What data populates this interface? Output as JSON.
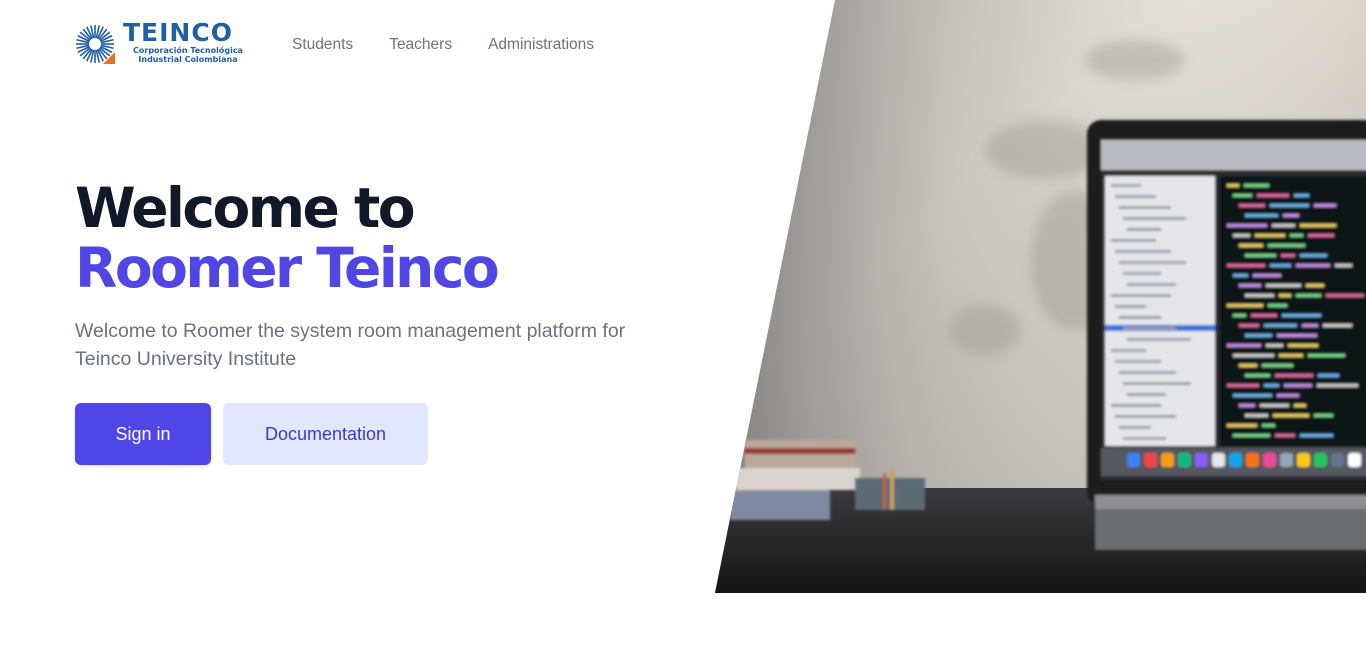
{
  "brand": {
    "name": "TEINCO",
    "subtitle_line1": "Corporación Tecnológica",
    "subtitle_line2": "Industrial Colombiana",
    "color": "#1f5fa6",
    "accent": "#e37222"
  },
  "nav": {
    "items": [
      {
        "label": "Students"
      },
      {
        "label": "Teachers"
      },
      {
        "label": "Administrations"
      }
    ]
  },
  "hero": {
    "title_line1": "Welcome to",
    "title_line2": "Roomer Teinco",
    "description": "Welcome to Roomer the system room management platform for Teinco University Institute",
    "primary_button": "Sign in",
    "secondary_button": "Documentation",
    "image_icon": "laptop-on-desk-photo"
  },
  "colors": {
    "accent": "#4f46e5",
    "accent_light": "#e0e7ff",
    "title": "#111827",
    "text_muted": "#6b7280"
  }
}
